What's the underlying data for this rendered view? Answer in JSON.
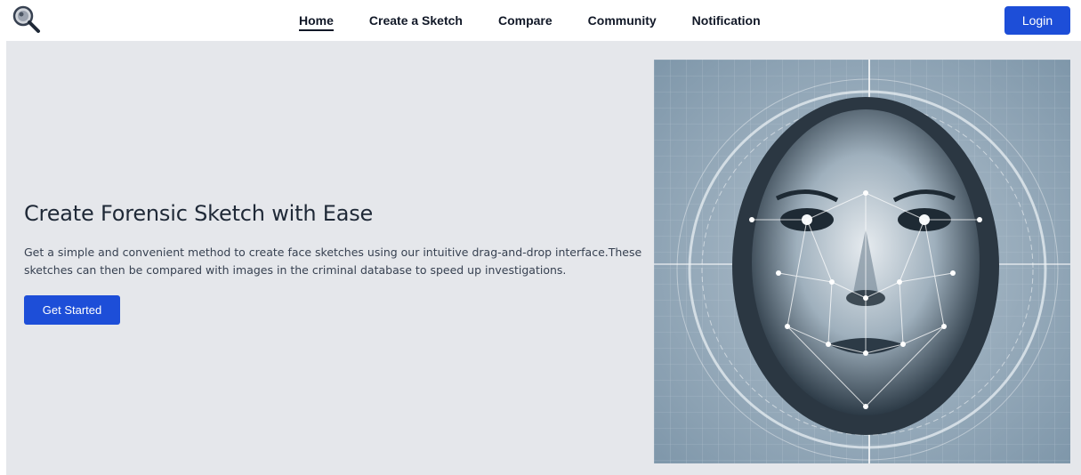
{
  "nav": {
    "logo_icon": "magnifier-icon",
    "links": [
      {
        "label": "Home",
        "active": true
      },
      {
        "label": "Create a Sketch",
        "active": false
      },
      {
        "label": "Compare",
        "active": false
      },
      {
        "label": "Community",
        "active": false
      },
      {
        "label": "Notification",
        "active": false
      }
    ],
    "login_label": "Login"
  },
  "hero": {
    "title": "Create Forensic Sketch with Ease",
    "description": "Get a simple and convenient method to create face sketches using our intuitive drag-and-drop interface.These sketches can then be compared with images in the criminal database to speed up investigations.",
    "cta_label": "Get Started"
  },
  "colors": {
    "accent": "#1d4ed8",
    "hero_bg": "#e5e7eb",
    "image_bg": "#8aa2b6"
  }
}
